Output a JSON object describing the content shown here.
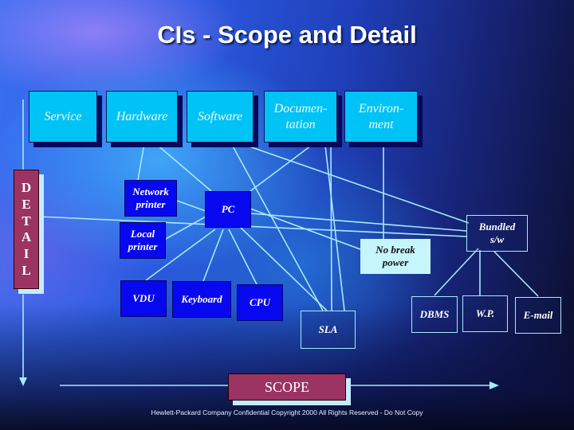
{
  "slide": {
    "title": "CIs - Scope and Detail",
    "footer": "Hewlett-Packard Company Confidential Copyright 2000 All Rights Reserved - Do Not Copy"
  },
  "categories": [
    {
      "id": "service",
      "label": "Service"
    },
    {
      "id": "hardware",
      "label": "Hardware"
    },
    {
      "id": "software",
      "label": "Software"
    },
    {
      "id": "documentation",
      "label": "Documen-\ntation"
    },
    {
      "id": "environment",
      "label": "Environ-\nment"
    }
  ],
  "nodes": {
    "network_printer": "Network\nprinter",
    "local_printer": "Local\nprinter",
    "pc": "PC",
    "vdu": "VDU",
    "keyboard": "Keyboard",
    "cpu": "CPU",
    "sla": "SLA",
    "no_break_power": "No break\npower",
    "bundled_sw": "Bundled\ns/w",
    "dbms": "DBMS",
    "wp": "W.P.",
    "email": "E-mail"
  },
  "axes": {
    "detail_label": "DETAIL",
    "detail_letters": [
      "D",
      "E",
      "T",
      "A",
      "I",
      "L"
    ],
    "scope_label": "SCOPE"
  },
  "colors": {
    "category_box": "#00c3f5",
    "hardware_box": "#0808f0",
    "axis_label_box": "#9b3363",
    "connector_line": "#a8e8ff"
  }
}
